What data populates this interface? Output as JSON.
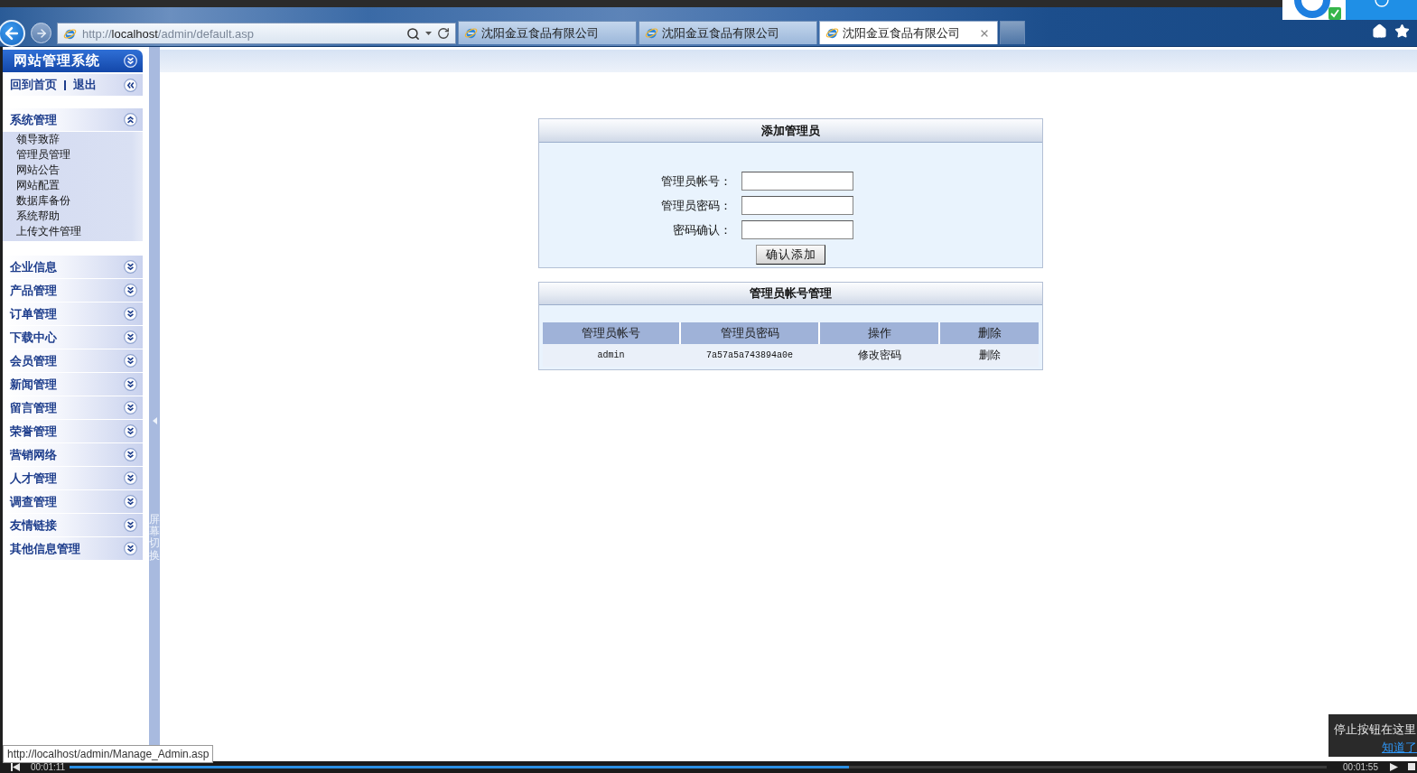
{
  "browser": {
    "address": {
      "scheme": "http://",
      "host": "localhost",
      "path": "/admin/default.asp"
    },
    "tabs": [
      {
        "title": "沈阳金豆食品有限公司",
        "selected": false
      },
      {
        "title": "沈阳金豆食品有限公司",
        "selected": false
      },
      {
        "title": "沈阳金豆食品有限公司",
        "selected": true
      }
    ]
  },
  "sidebar": {
    "title": "网站管理系统",
    "links": [
      "回到首页",
      "退出"
    ],
    "sections": [
      {
        "label": "系统管理",
        "expanded": true,
        "children": [
          {
            "label": "领导致辞"
          },
          {
            "label": "管理员管理"
          },
          {
            "label": "网站公告"
          },
          {
            "label": "网站配置"
          },
          {
            "label": "数据库备份"
          },
          {
            "label": "系统帮助"
          },
          {
            "label": "上传文件管理"
          }
        ]
      },
      {
        "label": "企业信息",
        "expanded": false
      },
      {
        "label": "产品管理",
        "expanded": false
      },
      {
        "label": "订单管理",
        "expanded": false
      },
      {
        "label": "下载中心",
        "expanded": false
      },
      {
        "label": "会员管理",
        "expanded": false
      },
      {
        "label": "新闻管理",
        "expanded": false
      },
      {
        "label": "留言管理",
        "expanded": false
      },
      {
        "label": "荣誉管理",
        "expanded": false
      },
      {
        "label": "营销网络",
        "expanded": false
      },
      {
        "label": "人才管理",
        "expanded": false
      },
      {
        "label": "调查管理",
        "expanded": false
      },
      {
        "label": "友情链接",
        "expanded": false
      },
      {
        "label": "其他信息管理",
        "expanded": false
      }
    ]
  },
  "splitter": {
    "label": "屏幕切换"
  },
  "add_admin": {
    "title": "添加管理员",
    "fields": [
      {
        "label": "管理员帐号："
      },
      {
        "label": "管理员密码："
      },
      {
        "label": "密码确认："
      }
    ],
    "submit": "确认添加"
  },
  "admin_accounts": {
    "title": "管理员帐号管理",
    "columns": [
      "管理员帐号",
      "管理员密码",
      "操作",
      "删除"
    ],
    "rows": [
      {
        "cells": [
          {
            "text": "admin",
            "kind": "code"
          },
          {
            "text": "7a57a5a743894a0e",
            "kind": "code"
          },
          {
            "text": "修改密码",
            "kind": "link"
          },
          {
            "text": "删除",
            "kind": "link"
          }
        ]
      }
    ]
  },
  "status_bar": {
    "url": "http://localhost/admin/Manage_Admin.asp"
  },
  "tip": {
    "message": "停止按钮在这里",
    "action": "知道了"
  },
  "player": {
    "elapsed": "00:01:11",
    "total": "00:01:55",
    "level": 0.62
  }
}
